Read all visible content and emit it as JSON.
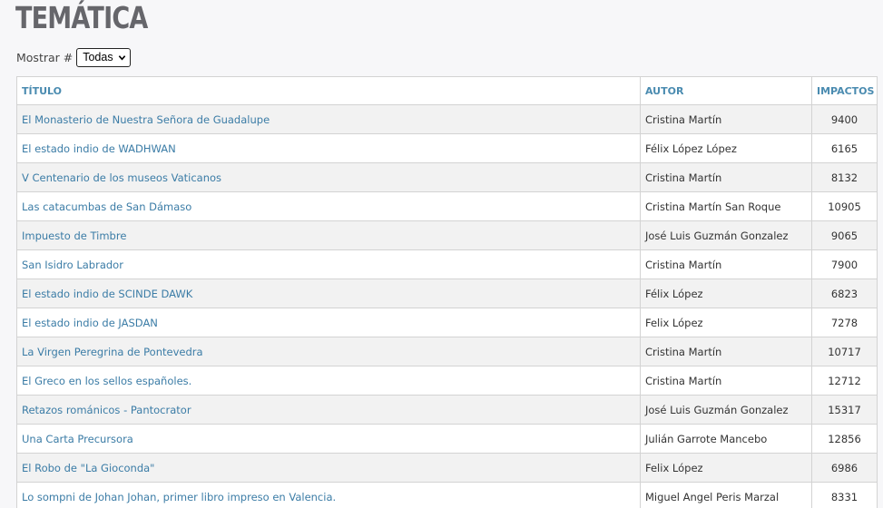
{
  "page": {
    "title": "TEMÁTICA"
  },
  "filter": {
    "label": "Mostrar #",
    "selected": "Todas"
  },
  "table": {
    "headers": {
      "title": "TÍTULO",
      "author": "AUTOR",
      "impacts": "IMPACTOS"
    },
    "rows": [
      {
        "title": "El Monasterio de Nuestra Señora de Guadalupe",
        "author": "Cristina Martín",
        "impacts": "9400"
      },
      {
        "title": "El estado indio de WADHWAN",
        "author": "Félix López López",
        "impacts": "6165"
      },
      {
        "title": "V Centenario de los museos Vaticanos",
        "author": "Cristina Martín",
        "impacts": "8132"
      },
      {
        "title": "Las catacumbas de San Dámaso",
        "author": "Cristina Martín San Roque",
        "impacts": "10905"
      },
      {
        "title": "Impuesto de Timbre",
        "author": "José Luis Guzmán Gonzalez",
        "impacts": "9065"
      },
      {
        "title": "San Isidro Labrador",
        "author": "Cristina Martín",
        "impacts": "7900"
      },
      {
        "title": "El estado indio de SCINDE DAWK",
        "author": "Félix López",
        "impacts": "6823"
      },
      {
        "title": "El estado indio de JASDAN",
        "author": "Felix López",
        "impacts": "7278"
      },
      {
        "title": "La Virgen Peregrina de Pontevedra",
        "author": "Cristina Martín",
        "impacts": "10717"
      },
      {
        "title": "El Greco en los sellos españoles.",
        "author": "Cristina Martín",
        "impacts": "12712"
      },
      {
        "title": "Retazos románicos - Pantocrator",
        "author": "José Luis Guzmán Gonzalez",
        "impacts": "15317"
      },
      {
        "title": "Una Carta Precursora",
        "author": "Julián Garrote Mancebo",
        "impacts": "12856"
      },
      {
        "title": "El Robo de \"La Gioconda\"",
        "author": "Felix López",
        "impacts": "6986"
      },
      {
        "title": "Lo sompni de Johan Johan, primer libro impreso en Valencia.",
        "author": "Miguel Angel Peris Marzal",
        "impacts": "8331"
      }
    ]
  },
  "icons": {
    "select_arrow": "chevron-down-icon"
  },
  "colors": {
    "title": "#66666b",
    "link": "#3b7ca6",
    "header": "#4a8bb0",
    "stripe": "#f2f2f2",
    "border": "#d3d3d3"
  }
}
